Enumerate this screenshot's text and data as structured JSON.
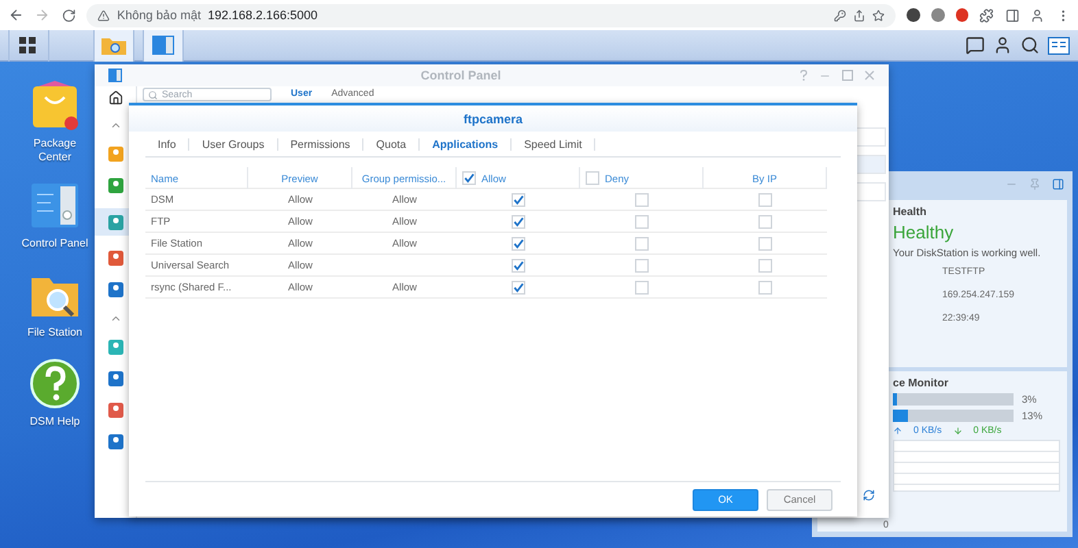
{
  "browser": {
    "security_label": "Không bảo mật",
    "url": "192.168.2.166:5000"
  },
  "desktop_icons": [
    {
      "kind": "package",
      "label": "Package Center"
    },
    {
      "kind": "panel",
      "label": "Control Panel"
    },
    {
      "kind": "folder",
      "label": "File Station"
    },
    {
      "kind": "help",
      "label": "DSM Help"
    }
  ],
  "control_panel": {
    "title": "Control Panel",
    "search": {
      "placeholder": "Search"
    },
    "tabs": [
      {
        "label": "User",
        "selected": true
      },
      {
        "label": "Advanced",
        "selected": false
      }
    ]
  },
  "dialog": {
    "title": "ftpcamera",
    "tabs": [
      {
        "label": "Info",
        "selected": false
      },
      {
        "label": "User Groups",
        "selected": false
      },
      {
        "label": "Permissions",
        "selected": false
      },
      {
        "label": "Quota",
        "selected": false
      },
      {
        "label": "Applications",
        "selected": true
      },
      {
        "label": "Speed Limit",
        "selected": false
      }
    ],
    "columns": [
      {
        "kind": "text",
        "label": "Name"
      },
      {
        "kind": "text",
        "label": "Preview"
      },
      {
        "kind": "text",
        "label": "Group permissio..."
      },
      {
        "kind": "checkbox",
        "label": "Allow",
        "checked": true
      },
      {
        "kind": "checkbox",
        "label": "Deny",
        "checked": false
      },
      {
        "kind": "text",
        "label": "By IP"
      }
    ],
    "rows": [
      {
        "name": "DSM",
        "preview": "Allow",
        "group": "Allow",
        "allow": true,
        "deny": false,
        "by_ip": false
      },
      {
        "name": "FTP",
        "preview": "Allow",
        "group": "Allow",
        "allow": true,
        "deny": false,
        "by_ip": false
      },
      {
        "name": "File Station",
        "preview": "Allow",
        "group": "Allow",
        "allow": true,
        "deny": false,
        "by_ip": false
      },
      {
        "name": "Universal Search",
        "preview": "Allow",
        "allow": true,
        "deny": false,
        "by_ip": false
      },
      {
        "name": "rsync (Shared F...",
        "preview": "Allow",
        "group": "Allow",
        "allow": true,
        "deny": false,
        "by_ip": false
      }
    ],
    "buttons": [
      {
        "kind": "primary",
        "label": "OK"
      },
      {
        "kind": "secondary",
        "label": "Cancel"
      }
    ]
  },
  "widgets": {
    "health": {
      "heading": "Health",
      "status": "Healthy",
      "message": "Your DiskStation is working well.",
      "details": [
        "TESTFTP",
        "169.254.247.159",
        "22:39:49"
      ]
    },
    "resource": {
      "heading": "ce Monitor",
      "meters": [
        {
          "level": 0.03,
          "reading": "3%"
        },
        {
          "level": 0.13,
          "reading": "13%"
        }
      ],
      "upload": "0 KB/s",
      "download": "0 KB/s",
      "axis_label": "0"
    }
  }
}
